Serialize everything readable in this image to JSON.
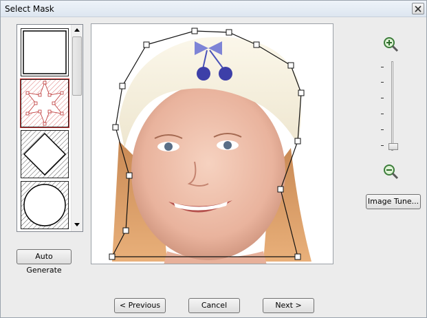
{
  "window": {
    "title": "Select Mask"
  },
  "buttons": {
    "auto_generate": "Auto Generate",
    "image_tune": "Image Tune...",
    "previous": "< Previous",
    "cancel": "Cancel",
    "next": "Next >"
  },
  "mask_shapes": [
    {
      "shape": "rectangle",
      "selected": false
    },
    {
      "shape": "star",
      "selected": true
    },
    {
      "shape": "diamond",
      "selected": false
    },
    {
      "shape": "circle",
      "selected": false
    }
  ],
  "icons": {
    "zoom_in": "zoom-in-icon",
    "zoom_out": "zoom-out-icon",
    "close": "close-icon"
  },
  "zoom": {
    "level": 0
  },
  "colors": {
    "selected_outline": "#cc3333",
    "window_bg": "#ececec"
  }
}
